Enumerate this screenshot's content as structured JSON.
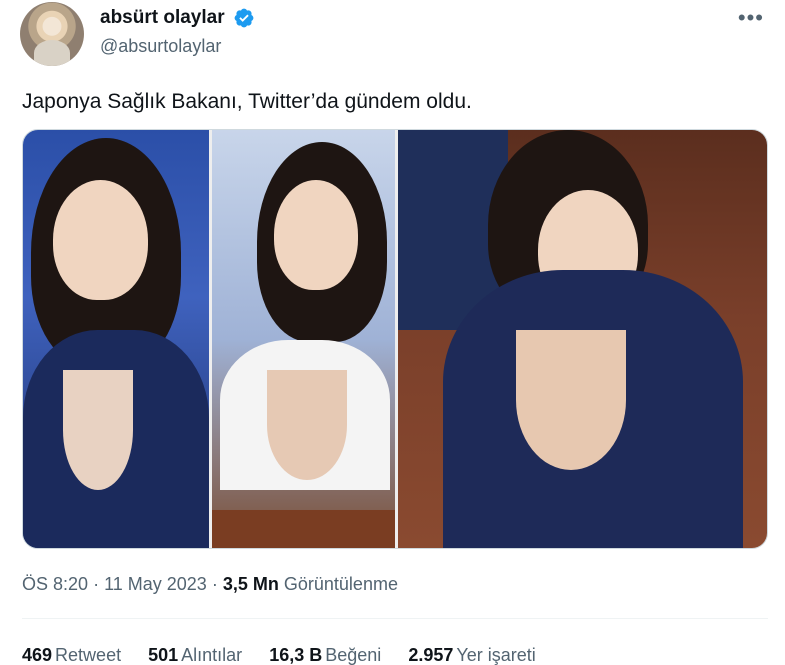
{
  "author": {
    "display_name": "absürt olaylar",
    "handle": "@absurtolaylar",
    "verified": true
  },
  "tweet": {
    "text": "Japonya Sağlık Bakanı, Twitter’da gündem oldu."
  },
  "media": {
    "count": 3
  },
  "meta": {
    "time": "ÖS 8:20",
    "date": "11 May 2023",
    "separator": "·",
    "views_count": "3,5 Mn",
    "views_label": "Görüntülenme"
  },
  "stats": [
    {
      "count": "469",
      "label": "Retweet"
    },
    {
      "count": "501",
      "label": "Alıntılar"
    },
    {
      "count": "16,3 B",
      "label": "Beğeni"
    },
    {
      "count": "2.957",
      "label": "Yer işareti"
    }
  ],
  "colors": {
    "text": "#0f1419",
    "secondary": "#536471",
    "verified": "#1d9bf0",
    "border": "#cfd9de"
  },
  "icons": {
    "verified": "verified-badge-icon",
    "more": "more-horizontal-icon"
  }
}
